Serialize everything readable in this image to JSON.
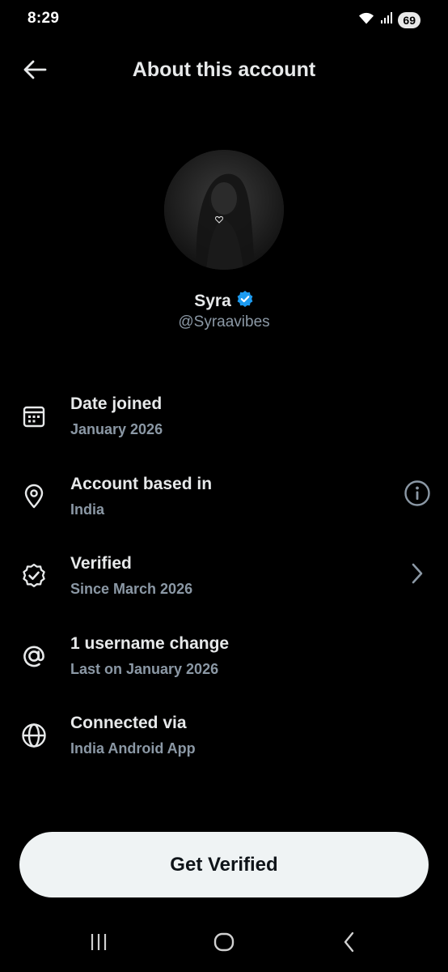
{
  "status_bar": {
    "time": "8:29",
    "battery": "69",
    "icons": [
      "wifi-icon",
      "signal-icon",
      "battery-icon"
    ]
  },
  "header": {
    "title": "About this account",
    "back_icon": "arrow-left-icon"
  },
  "profile": {
    "display_name": "Syra",
    "handle": "@Syraavibes",
    "verified": true,
    "verified_color": "#1d9bf0"
  },
  "info_rows": [
    {
      "icon": "calendar-icon",
      "title": "Date joined",
      "subtitle": "January 2026"
    },
    {
      "icon": "location-pin-icon",
      "title": "Account based in",
      "subtitle": "India",
      "trailing": "info-icon"
    },
    {
      "icon": "verified-badge-icon",
      "title": "Verified",
      "subtitle": "Since March 2026",
      "trailing": "chevron-right-icon"
    },
    {
      "icon": "at-sign-icon",
      "title": "1 username change",
      "subtitle": "Last on January 2026"
    },
    {
      "icon": "globe-icon",
      "title": "Connected via",
      "subtitle": "India Android App"
    }
  ],
  "cta": {
    "label": "Get Verified"
  },
  "nav_bar": {
    "buttons": [
      "recents-icon",
      "home-icon",
      "back-icon"
    ]
  },
  "colors": {
    "background": "#000000",
    "primary_text": "#e7e9ea",
    "secondary_text": "#8b98a5",
    "cta_background": "#eff3f4"
  }
}
